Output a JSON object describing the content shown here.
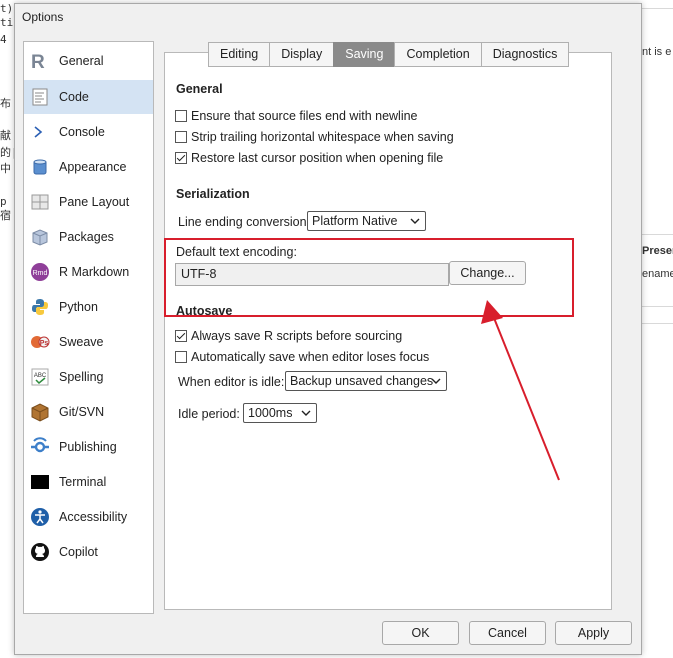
{
  "background": {
    "left_fragments": [
      "t)",
      "ti",
      "4",
      "",
      "",
      "",
      "布",
      "",
      "献",
      "的|",
      "中",
      "",
      "p",
      "宿"
    ],
    "right_fragments": [
      "nt is e",
      "Presen",
      "ename"
    ]
  },
  "dialog": {
    "title": "Options",
    "sidebar": {
      "items": [
        {
          "label": "General",
          "icon": "r-logo-icon"
        },
        {
          "label": "Code",
          "icon": "code-page-icon"
        },
        {
          "label": "Console",
          "icon": "console-prompt-icon"
        },
        {
          "label": "Appearance",
          "icon": "appearance-bucket-icon"
        },
        {
          "label": "Pane Layout",
          "icon": "pane-layout-icon"
        },
        {
          "label": "Packages",
          "icon": "packages-box-icon"
        },
        {
          "label": "R Markdown",
          "icon": "rmd-icon"
        },
        {
          "label": "Python",
          "icon": "python-icon"
        },
        {
          "label": "Sweave",
          "icon": "sweave-icon"
        },
        {
          "label": "Spelling",
          "icon": "spelling-abc-icon"
        },
        {
          "label": "Git/SVN",
          "icon": "git-box-icon"
        },
        {
          "label": "Publishing",
          "icon": "publishing-icon"
        },
        {
          "label": "Terminal",
          "icon": "terminal-icon"
        },
        {
          "label": "Accessibility",
          "icon": "accessibility-icon"
        },
        {
          "label": "Copilot",
          "icon": "github-icon"
        }
      ],
      "active_index": 1
    },
    "tabs": [
      "Editing",
      "Display",
      "Saving",
      "Completion",
      "Diagnostics"
    ],
    "active_tab": "Saving",
    "sections": {
      "general": {
        "title": "General",
        "options": [
          {
            "label": "Ensure that source files end with newline",
            "checked": false
          },
          {
            "label": "Strip trailing horizontal whitespace when saving",
            "checked": false
          },
          {
            "label": "Restore last cursor position when opening file",
            "checked": true
          }
        ]
      },
      "serialization": {
        "title": "Serialization",
        "line_ending_label": "Line ending conversion:",
        "line_ending_value": "Platform Native",
        "encoding_label": "Default text encoding:",
        "encoding_value": "UTF-8",
        "change_button": "Change..."
      },
      "autosave": {
        "title": "Autosave",
        "options": [
          {
            "label": "Always save R scripts before sourcing",
            "checked": true
          },
          {
            "label": "Automatically save when editor loses focus",
            "checked": false
          }
        ],
        "idle_label": "When editor is idle:",
        "idle_value": "Backup unsaved changes",
        "period_label": "Idle period:",
        "period_value": "1000ms"
      }
    },
    "buttons": {
      "ok": "OK",
      "cancel": "Cancel",
      "apply": "Apply"
    }
  },
  "annotation_color": "#d81e2c"
}
